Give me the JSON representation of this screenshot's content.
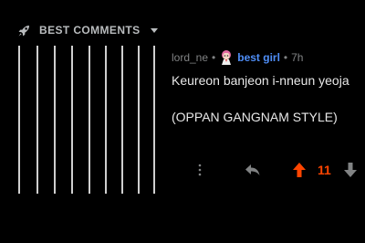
{
  "sort": {
    "label": "BEST COMMENTS",
    "icon": "rocket-icon",
    "dropdown_icon": "chevron-down-icon"
  },
  "comment": {
    "author": "lord_ne",
    "separator": "•",
    "flair_icon": "anime-avatar-icon",
    "flair": "best girl",
    "time_separator": "•",
    "time": "7h",
    "body_lines": [
      "Keureon banjeon i-nneun yeoja",
      "(OPPAN GANGNAM STYLE)"
    ],
    "score": "11"
  },
  "colors": {
    "background": "#000000",
    "upvoted": "#ff4500",
    "flair": "#4f8ef7",
    "meta": "#818384",
    "thread_line": "#cfcfcf"
  },
  "icons": {
    "more": "more-vertical-icon",
    "reply": "reply-icon",
    "upvote": "upvote-arrow-icon",
    "downvote": "downvote-arrow-icon"
  }
}
